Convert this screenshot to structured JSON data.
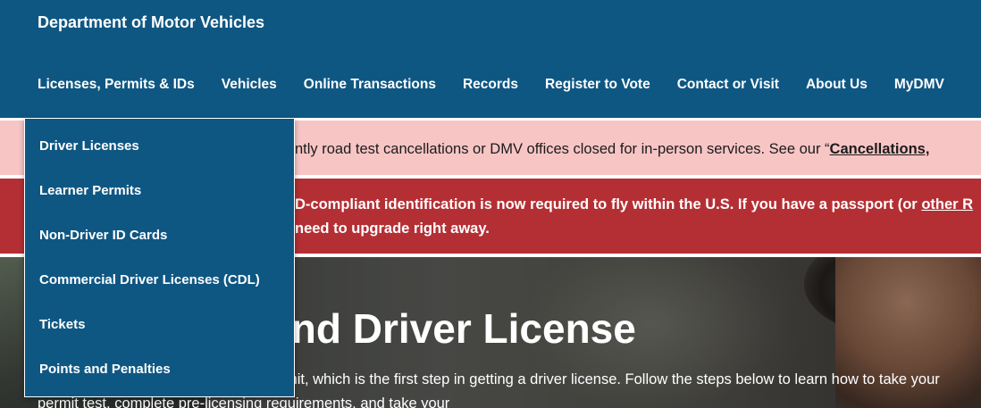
{
  "header": {
    "site_title": "Department of Motor Vehicles",
    "nav": [
      "Licenses, Permits & IDs",
      "Vehicles",
      "Online Transactions",
      "Records",
      "Register to Vote",
      "Contact or Visit",
      "About Us",
      "MyDMV"
    ]
  },
  "dropdown": {
    "items": [
      "Driver Licenses",
      "Learner Permits",
      "Non-Driver ID Cards",
      "Commercial Driver Licenses (CDL)",
      "Tickets",
      "Points and Penalties"
    ]
  },
  "alerts": {
    "closures": {
      "text": "ntly road test cancellations or DMV offices closed for in-person services. See our “",
      "link": "Cancellations,"
    },
    "real_id": {
      "line1": "D-compliant identification is now required to fly within the U.S. If you have a passport (or ",
      "line1_link": "other R",
      "line2": "need to upgrade right away."
    }
  },
  "hero": {
    "title": "rner Permit and Driver License",
    "description": "r can apply for a New York learner permit, which is the first step in getting a driver license. Follow the steps below to learn how to take your permit test, complete pre-licensing requirements, and take your"
  },
  "colors": {
    "header_bg": "#0f5783",
    "alert_pink": "#f8c5c5",
    "alert_red": "#b42f34"
  }
}
